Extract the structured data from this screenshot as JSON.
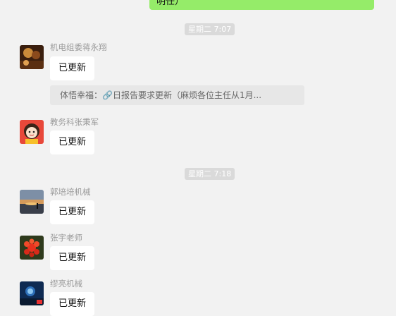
{
  "my_message": {
    "text": "明任）"
  },
  "timestamps": [
    "星期二 7:07",
    "星期二 7:18"
  ],
  "messages": [
    {
      "sender": "机电组委蒋永翔",
      "text": "已更新",
      "avatar_icon": "photo-avatar-icon"
    },
    {
      "sender": "教务科张秉军",
      "text": "已更新",
      "avatar_icon": "cartoon-girl-avatar-icon"
    },
    {
      "sender": "郭培培机械",
      "text": "已更新",
      "avatar_icon": "sunset-avatar-icon"
    },
    {
      "sender": "张宇老师",
      "text": "已更新",
      "avatar_icon": "red-flower-avatar-icon"
    },
    {
      "sender": "缪亮机械",
      "text": "已更新",
      "avatar_icon": "night-sky-avatar-icon"
    }
  ],
  "quote": {
    "text": "体悟幸福：🔗日报告要求更新（麻烦各位主任从1月..."
  },
  "colors": {
    "background": "#f2f2f2",
    "my_bubble": "#95ec69",
    "other_bubble": "#ffffff",
    "timestamp_bg": "#dadada",
    "quote_bg": "#e7e7e7",
    "sender_name": "#9a9a9a"
  }
}
